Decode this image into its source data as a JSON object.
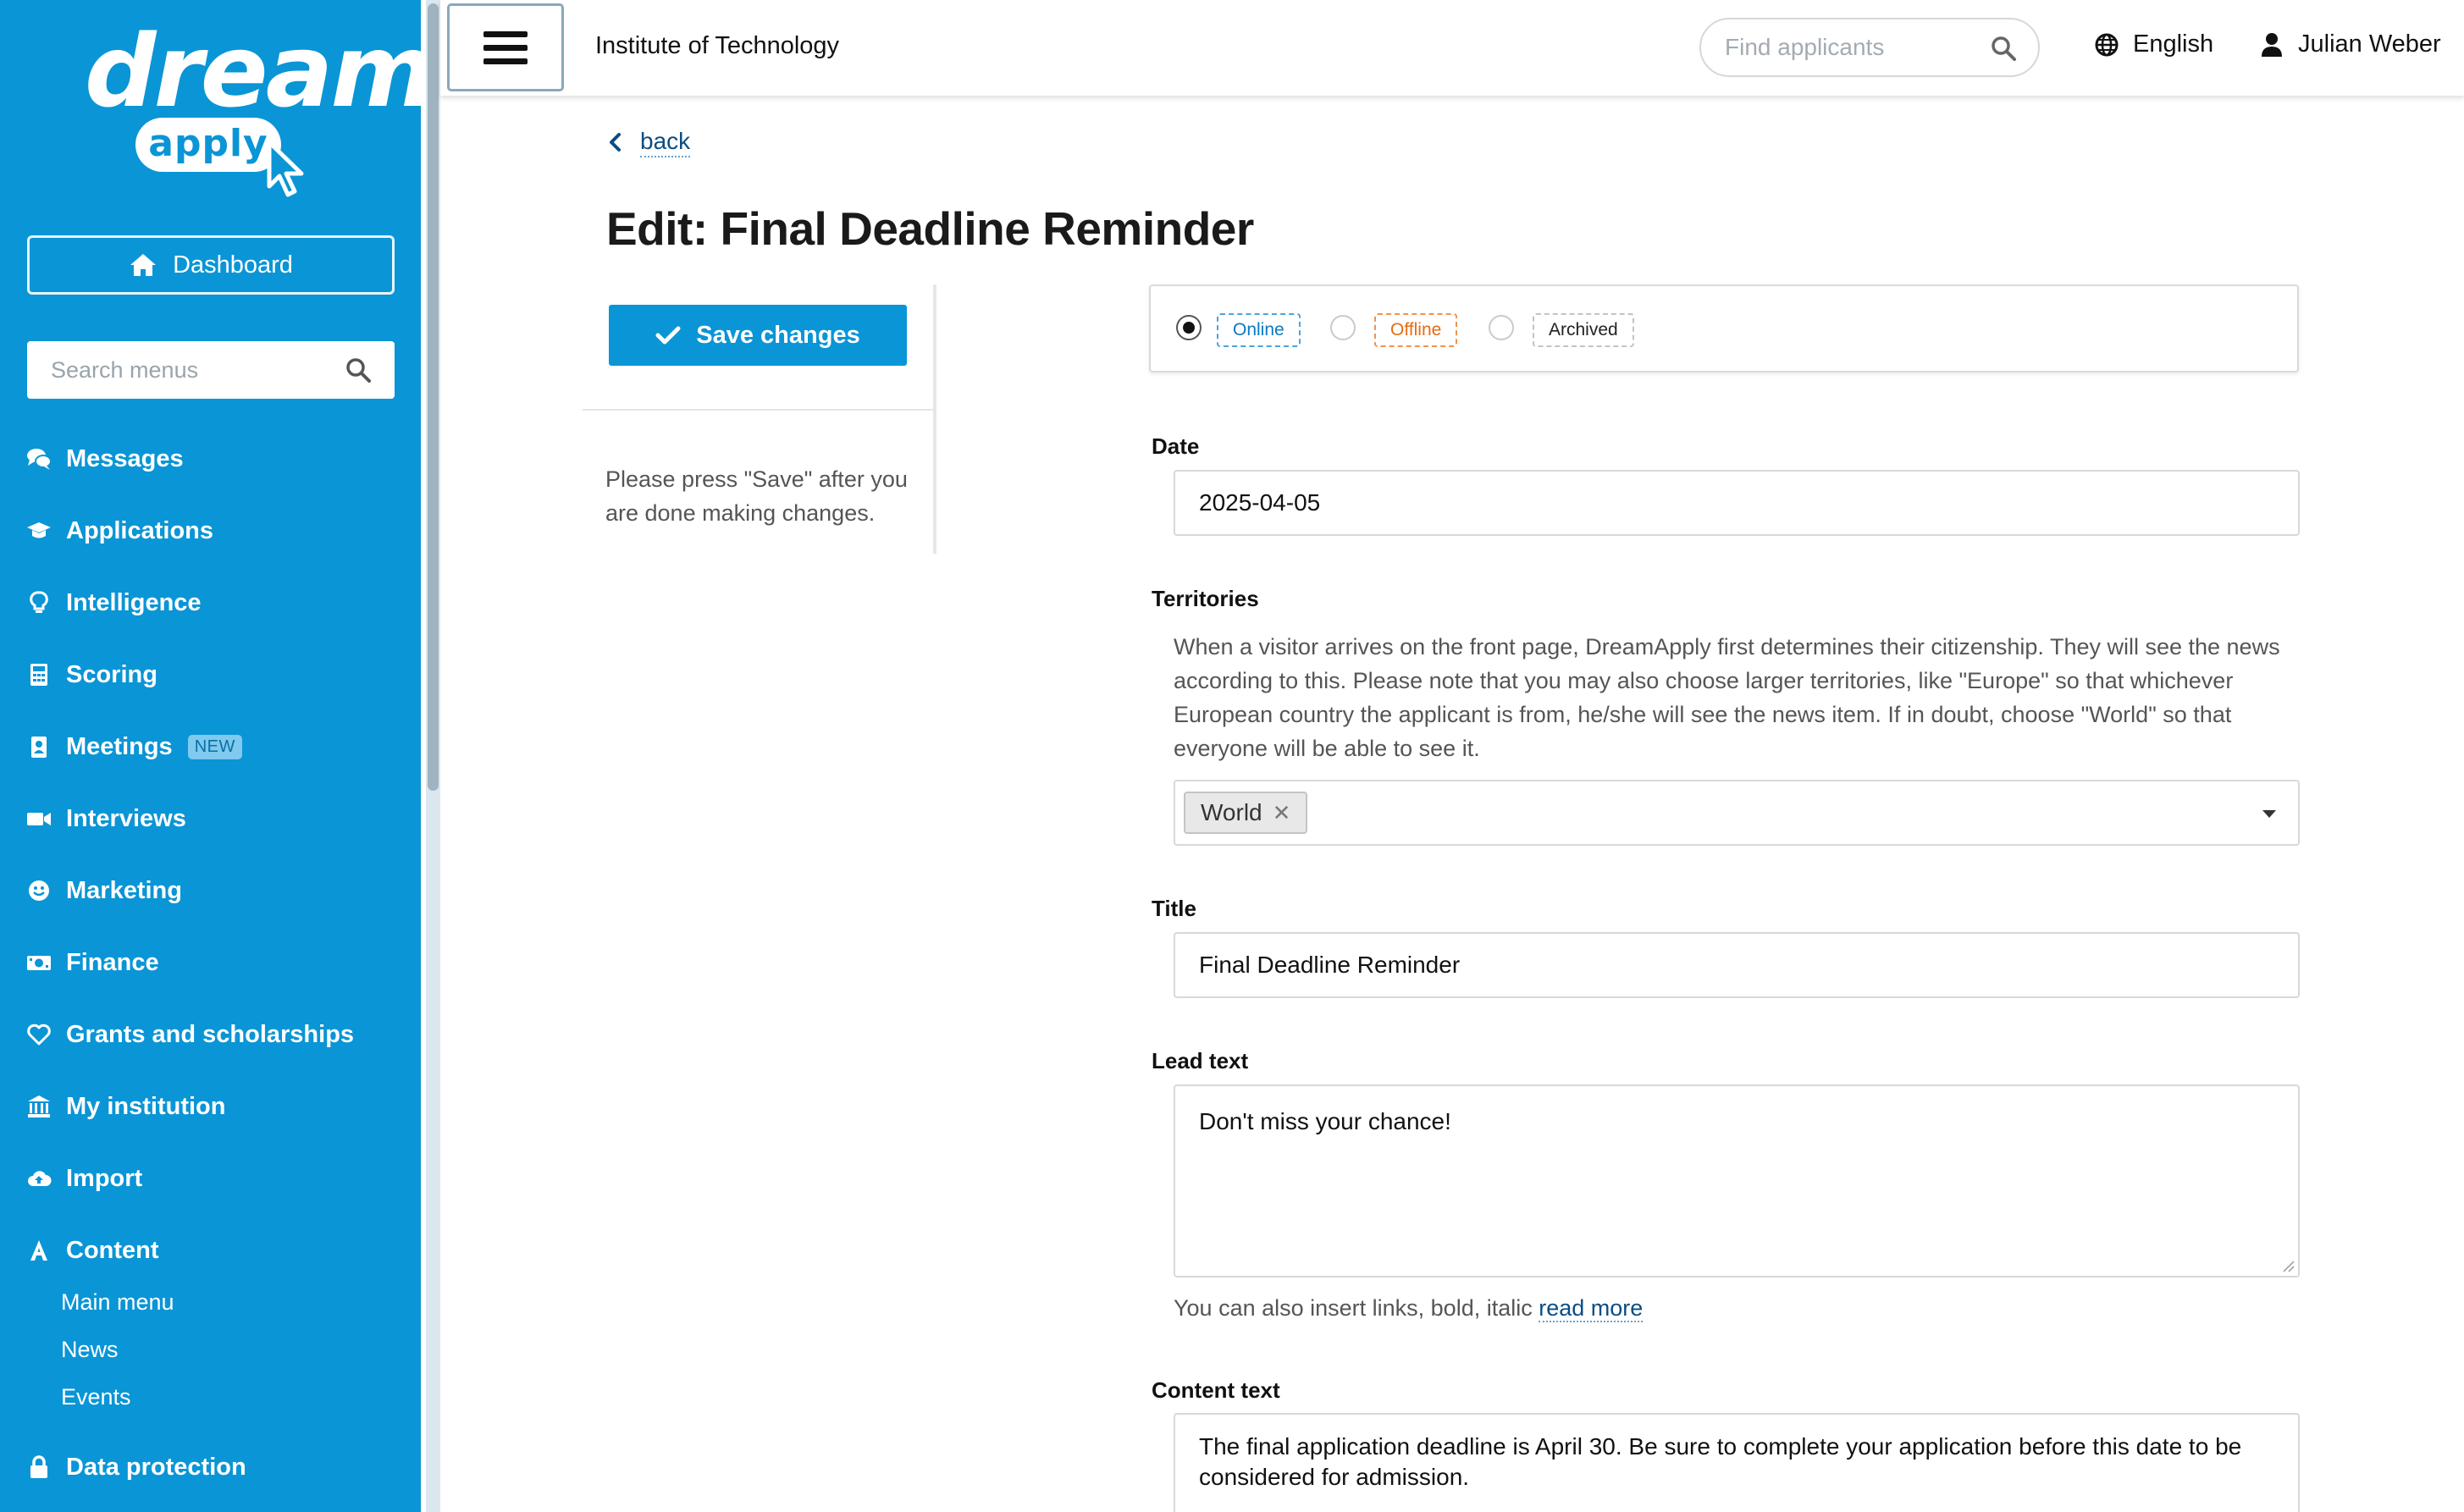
{
  "brand": {
    "logo_word": "dream",
    "logo_pill": "apply"
  },
  "sidebar": {
    "dashboard_label": "Dashboard",
    "search_placeholder": "Search menus",
    "items": [
      {
        "label": "Messages",
        "icon": "chat-icon"
      },
      {
        "label": "Applications",
        "icon": "graduation-cap-icon"
      },
      {
        "label": "Intelligence",
        "icon": "lightbulb-icon"
      },
      {
        "label": "Scoring",
        "icon": "calculator-icon"
      },
      {
        "label": "Meetings",
        "icon": "calendar-user-icon",
        "badge": "NEW"
      },
      {
        "label": "Interviews",
        "icon": "video-icon"
      },
      {
        "label": "Marketing",
        "icon": "smile-icon"
      },
      {
        "label": "Finance",
        "icon": "money-icon"
      },
      {
        "label": "Grants and scholarships",
        "icon": "heart-icon"
      },
      {
        "label": "My institution",
        "icon": "institution-icon"
      },
      {
        "label": "Import",
        "icon": "cloud-upload-icon"
      },
      {
        "label": "Content",
        "icon": "font-icon"
      },
      {
        "label": "Data protection",
        "icon": "lock-icon"
      }
    ],
    "content_subitems": [
      "Main menu",
      "News",
      "Events"
    ]
  },
  "topbar": {
    "institution": "Institute of Technology",
    "find_placeholder": "Find applicants",
    "language": "English",
    "user": "Julian Weber"
  },
  "main": {
    "back_label": "back",
    "title": "Edit: Final Deadline Reminder",
    "save_label": "Save changes",
    "save_note": "Please press \"Save\" after you are done making changes.",
    "status": {
      "options": [
        "Online",
        "Offline",
        "Archived"
      ],
      "selected": "Online"
    },
    "date": {
      "label": "Date",
      "value": "2025-04-05"
    },
    "territories": {
      "label": "Territories",
      "help": "When a visitor arrives on the front page, DreamApply first determines their citizenship. They will see the news according to this. Please note that you may also choose larger territories, like \"Europe\" so that whichever European country the applicant is from, he/she will see the news item. If in doubt, choose \"World\" so that everyone will be able to see it.",
      "selected": [
        "World"
      ]
    },
    "title_field": {
      "label": "Title",
      "value": "Final Deadline Reminder"
    },
    "lead_text": {
      "label": "Lead text",
      "value": "Don't miss your chance!",
      "help_prefix": "You can also insert links, bold, italic",
      "help_link": "read more"
    },
    "content_text": {
      "label": "Content text",
      "value": "The final application deadline is April 30. Be sure to complete your application before this date to be considered for admission."
    }
  },
  "colors": {
    "brand_blue": "#0a95d6",
    "online": "#0a78c0",
    "offline": "#e86a14",
    "link": "#0a4d83"
  }
}
